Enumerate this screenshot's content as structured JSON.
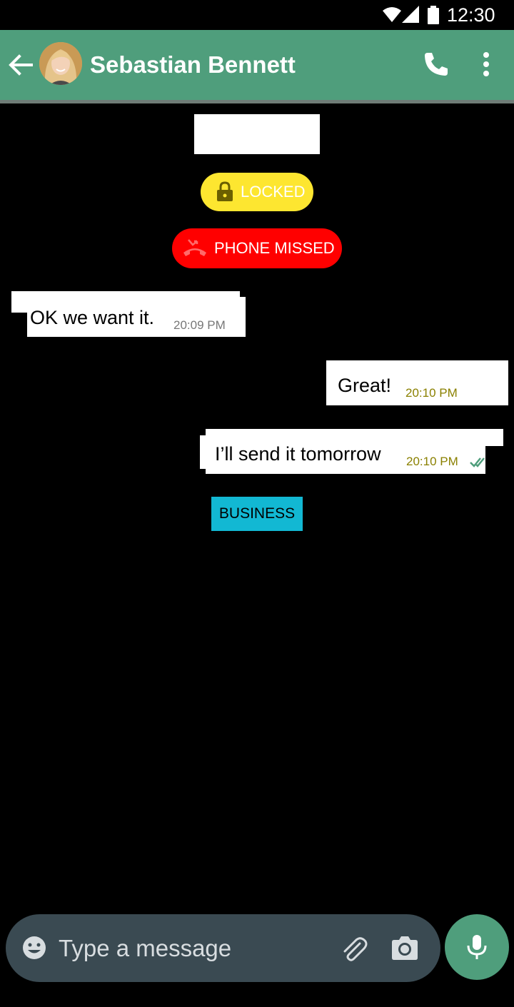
{
  "status_bar": {
    "time": "12:30",
    "icons": [
      "wifi-icon",
      "signal-icon",
      "battery-icon"
    ]
  },
  "header": {
    "contact_name": "Sebastian Bennett",
    "icons": [
      "back-arrow-icon",
      "avatar",
      "phone-icon",
      "more-vert-icon"
    ],
    "color": "#4f9e7c"
  },
  "chat": {
    "date_label": "",
    "locked_badge": {
      "label": "LOCKED",
      "icon": "lock-icon",
      "color": "#fde630"
    },
    "missed_badge": {
      "label": "PHONE MISSED",
      "icon": "missed-call-icon",
      "color": "#ff0000"
    },
    "messages": [
      {
        "direction": "incoming",
        "text": "OK we want it.",
        "time": "20:09 PM"
      },
      {
        "direction": "outgoing",
        "text": "Great!",
        "time": "20:10 PM"
      },
      {
        "direction": "outgoing",
        "text": "I’ll send it tomorrow",
        "time": "20:10 PM",
        "status": "double-check-icon"
      }
    ],
    "business_label": "BUSINESS",
    "business_color": "#12b8d3"
  },
  "composer": {
    "placeholder": "Type a message",
    "icons": [
      "emoji-icon",
      "attach-icon",
      "camera-icon",
      "mic-icon"
    ]
  }
}
